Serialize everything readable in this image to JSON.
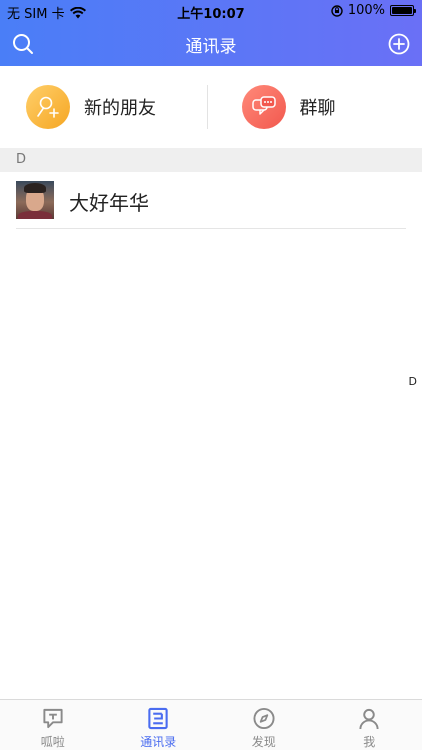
{
  "status_bar": {
    "carrier": "无 SIM 卡",
    "time": "上午10:07",
    "battery": "100%"
  },
  "nav": {
    "title": "通讯录"
  },
  "shortcuts": [
    {
      "label": "新的朋友",
      "icon": "new-friend-icon",
      "color": "#f5a623"
    },
    {
      "label": "群聊",
      "icon": "group-chat-icon",
      "color": "#f2584e"
    }
  ],
  "sections": [
    {
      "letter": "D",
      "contacts": [
        {
          "name": "大好年华",
          "avatar": "avatar"
        }
      ]
    }
  ],
  "index_letters": [
    "D"
  ],
  "tabs": [
    {
      "label": "呱啦",
      "icon": "chat-bubble-icon",
      "active": false
    },
    {
      "label": "通讯录",
      "icon": "contacts-icon",
      "active": true
    },
    {
      "label": "发现",
      "icon": "compass-icon",
      "active": false
    },
    {
      "label": "我",
      "icon": "person-icon",
      "active": false
    }
  ],
  "colors": {
    "header_start": "#4a7ef7",
    "header_end": "#6a70f6",
    "tab_active": "#4a6cf0",
    "tab_inactive": "#8a8a8a"
  }
}
